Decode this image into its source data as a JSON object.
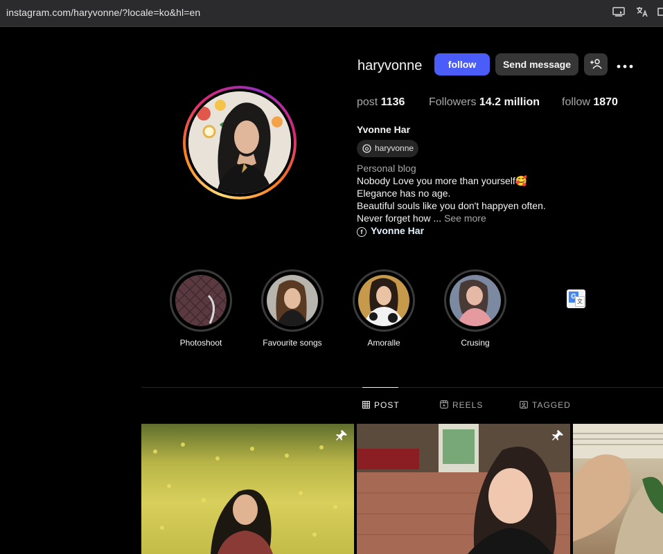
{
  "browser": {
    "url": "instagram.com/haryvonne/?locale=ko&hl=en"
  },
  "profile": {
    "username": "haryvonne",
    "follow_label": "follow",
    "message_label": "Send message",
    "stats": {
      "posts_label": "post",
      "posts_value": "1136",
      "followers_label": "Followers",
      "followers_value": "14.2 million",
      "following_label": "follow",
      "following_value": "1870"
    },
    "full_name": "Yvonne Har",
    "threads_handle": "haryvonne",
    "category": "Personal blog",
    "bio": {
      "line1": "Nobody Love you more than yourself🥰",
      "line2": "Elegance has no age.",
      "line3": "Beautiful souls like you don't happyen often.",
      "line4": "Never forget how ...",
      "see_more": "See more"
    },
    "facebook_link": "Yvonne Har"
  },
  "highlights": [
    {
      "label": "Photoshoot"
    },
    {
      "label": "Favourite songs"
    },
    {
      "label": "Amoralle"
    },
    {
      "label": "Crusing"
    }
  ],
  "tabs": [
    {
      "label": "POST",
      "active": true
    },
    {
      "label": "REELS",
      "active": false
    },
    {
      "label": "TAGGED",
      "active": false
    }
  ],
  "icons": {
    "cast": "cast-icon",
    "translate": "translate-icon",
    "add_user": "add-user-icon",
    "more": "more-options-icon",
    "threads": "threads-icon",
    "facebook": "facebook-icon",
    "pin": "pin-icon",
    "grid": "grid-icon",
    "reels": "reels-icon",
    "tagged": "tagged-icon"
  },
  "colors": {
    "follow_button": "#4a5df9",
    "secondary_button": "#363636",
    "background": "#000000"
  }
}
